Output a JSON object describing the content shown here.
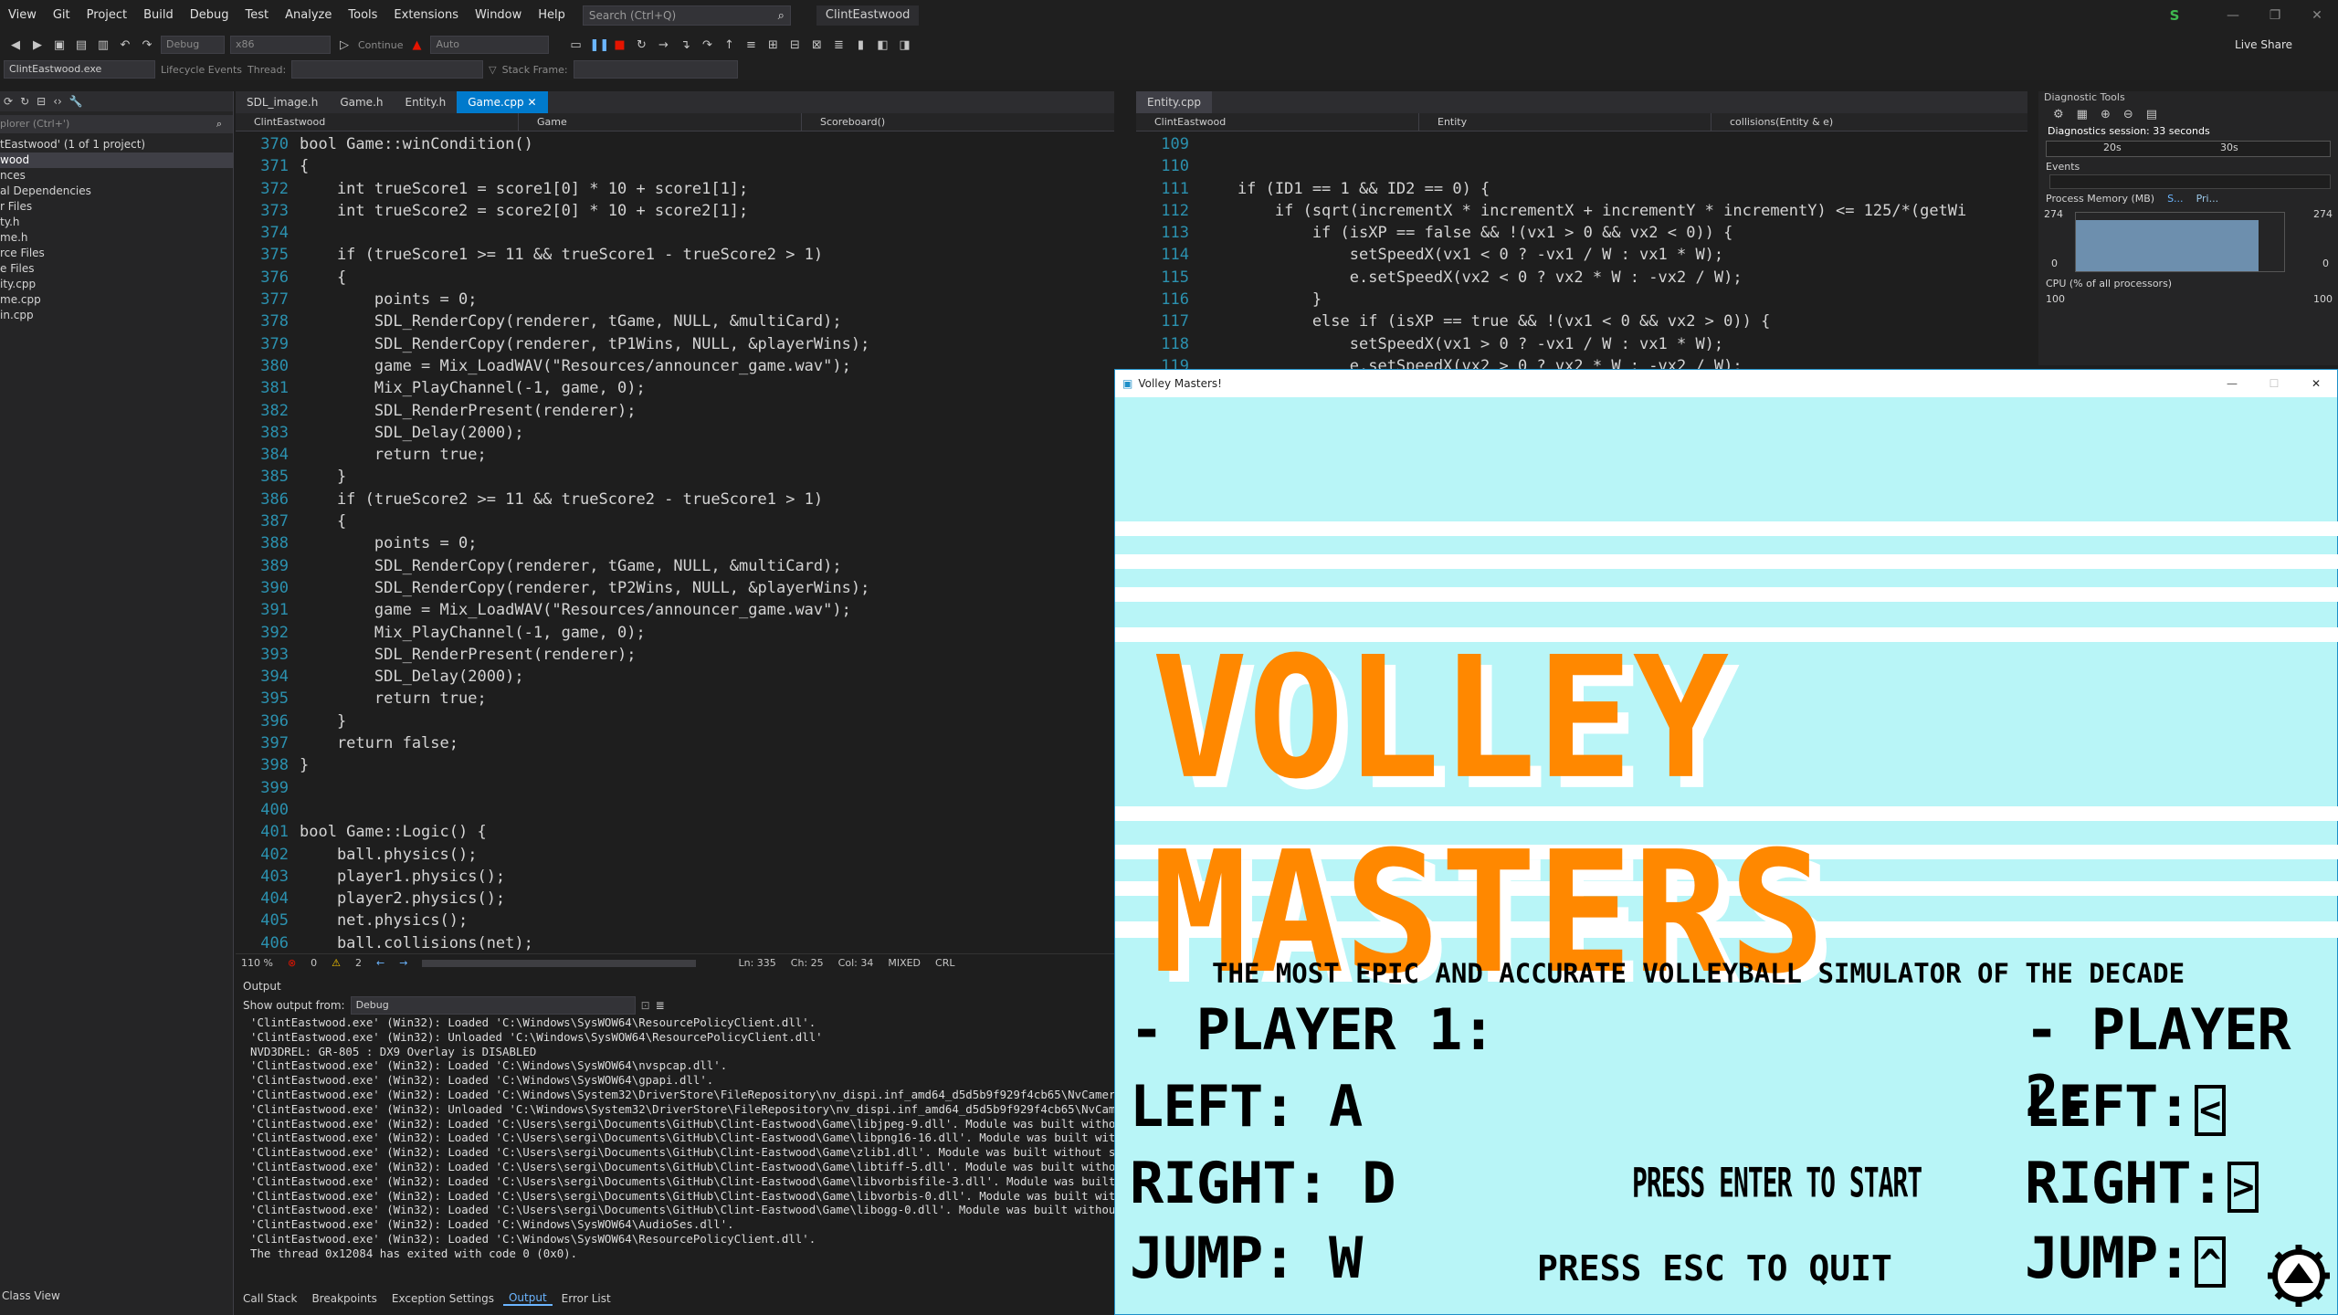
{
  "menu": {
    "items": [
      "View",
      "Git",
      "Project",
      "Build",
      "Debug",
      "Test",
      "Analyze",
      "Tools",
      "Extensions",
      "Window",
      "Help"
    ],
    "search_placeholder": "Search (Ctrl+Q)",
    "solution_name": "ClintEastwood",
    "user_initial": "S",
    "live_share": "Live Share"
  },
  "toolbar": {
    "config": "Debug",
    "platform": "x86",
    "continue": "Continue",
    "auto": "Auto",
    "process": "ClintEastwood.exe",
    "lifecycle": "Lifecycle Events",
    "thread": "Thread:",
    "stack_frame": "Stack Frame:"
  },
  "solution_explorer": {
    "search": "plorer (Ctrl+')",
    "rows": [
      "tEastwood' (1 of 1 project)",
      "wood",
      "nces",
      "al Dependencies",
      "r Files",
      "ty.h",
      "me.h",
      "rce Files",
      "e Files",
      "ity.cpp",
      "me.cpp",
      "in.cpp"
    ],
    "class_view": "Class View"
  },
  "editor_left": {
    "tabs": [
      "SDL_image.h",
      "Game.h",
      "Entity.h",
      "Game.cpp"
    ],
    "active_tab": "Game.cpp",
    "nav": [
      "ClintEastwood",
      "Game",
      "Scoreboard()"
    ],
    "zoom": "110 %",
    "errors": "0",
    "warnings": "2",
    "status_ln": "Ln: 335",
    "status_ch": "Ch: 25",
    "status_col": "Col: 34",
    "status_eol": "MIXED",
    "status_enc": "CRL"
  },
  "editor_right": {
    "tab": "Entity.cpp",
    "nav": [
      "ClintEastwood",
      "Entity",
      "collisions(Entity & e)"
    ]
  },
  "code_left": [
    {
      "n": "370",
      "t": "bool Game::winCondition()"
    },
    {
      "n": "371",
      "t": "{"
    },
    {
      "n": "372",
      "t": "    int trueScore1 = score1[0] * 10 + score1[1];"
    },
    {
      "n": "373",
      "t": "    int trueScore2 = score2[0] * 10 + score2[1];"
    },
    {
      "n": "374",
      "t": ""
    },
    {
      "n": "375",
      "t": "    if (trueScore1 >= 11 && trueScore1 - trueScore2 > 1)"
    },
    {
      "n": "376",
      "t": "    {"
    },
    {
      "n": "377",
      "t": "        points = 0;"
    },
    {
      "n": "378",
      "t": "        SDL_RenderCopy(renderer, tGame, NULL, &multiCard);"
    },
    {
      "n": "379",
      "t": "        SDL_RenderCopy(renderer, tP1Wins, NULL, &playerWins);"
    },
    {
      "n": "380",
      "t": "        game = Mix_LoadWAV(\"Resources/announcer_game.wav\");"
    },
    {
      "n": "381",
      "t": "        Mix_PlayChannel(-1, game, 0);"
    },
    {
      "n": "382",
      "t": "        SDL_RenderPresent(renderer);"
    },
    {
      "n": "383",
      "t": "        SDL_Delay(2000);"
    },
    {
      "n": "384",
      "t": "        return true;"
    },
    {
      "n": "385",
      "t": "    }"
    },
    {
      "n": "386",
      "t": "    if (trueScore2 >= 11 && trueScore2 - trueScore1 > 1)"
    },
    {
      "n": "387",
      "t": "    {"
    },
    {
      "n": "388",
      "t": "        points = 0;"
    },
    {
      "n": "389",
      "t": "        SDL_RenderCopy(renderer, tGame, NULL, &multiCard);"
    },
    {
      "n": "390",
      "t": "        SDL_RenderCopy(renderer, tP2Wins, NULL, &playerWins);"
    },
    {
      "n": "391",
      "t": "        game = Mix_LoadWAV(\"Resources/announcer_game.wav\");"
    },
    {
      "n": "392",
      "t": "        Mix_PlayChannel(-1, game, 0);"
    },
    {
      "n": "393",
      "t": "        SDL_RenderPresent(renderer);"
    },
    {
      "n": "394",
      "t": "        SDL_Delay(2000);"
    },
    {
      "n": "395",
      "t": "        return true;"
    },
    {
      "n": "396",
      "t": "    }"
    },
    {
      "n": "397",
      "t": "    return false;"
    },
    {
      "n": "398",
      "t": "}"
    },
    {
      "n": "399",
      "t": ""
    },
    {
      "n": "400",
      "t": ""
    },
    {
      "n": "401",
      "t": "bool Game::Logic() {"
    },
    {
      "n": "402",
      "t": "    ball.physics();"
    },
    {
      "n": "403",
      "t": "    player1.physics();"
    },
    {
      "n": "404",
      "t": "    player2.physics();"
    },
    {
      "n": "405",
      "t": "    net.physics();"
    },
    {
      "n": "406",
      "t": "    ball.collisions(net);"
    }
  ],
  "code_right": [
    {
      "n": "109",
      "t": ""
    },
    {
      "n": "110",
      "t": ""
    },
    {
      "n": "111",
      "t": "    if (ID1 == 1 && ID2 == 0) {"
    },
    {
      "n": "112",
      "t": "        if (sqrt(incrementX * incrementX + incrementY * incrementY) <= 125/*(getWi"
    },
    {
      "n": "113",
      "t": "            if (isXP == false && !(vx1 > 0 && vx2 < 0)) {"
    },
    {
      "n": "114",
      "t": "                setSpeedX(vx1 < 0 ? -vx1 / W : vx1 * W);"
    },
    {
      "n": "115",
      "t": "                e.setSpeedX(vx2 < 0 ? vx2 * W : -vx2 / W);"
    },
    {
      "n": "116",
      "t": "            }"
    },
    {
      "n": "117",
      "t": "            else if (isXP == true && !(vx1 < 0 && vx2 > 0)) {"
    },
    {
      "n": "118",
      "t": "                setSpeedX(vx1 > 0 ? -vx1 / W : vx1 * W);"
    },
    {
      "n": "119",
      "t": "                e.setSpeedX(vx2 > 0 ? vx2 * W : -vx2 / W);"
    }
  ],
  "output": {
    "title": "Output",
    "show_from_label": "Show output from:",
    "source": "Debug",
    "lines": [
      "'ClintEastwood.exe' (Win32): Loaded 'C:\\Windows\\SysWOW64\\ResourcePolicyClient.dll'.",
      "'ClintEastwood.exe' (Win32): Unloaded 'C:\\Windows\\SysWOW64\\ResourcePolicyClient.dll'",
      "NVD3DREL: GR-805 : DX9 Overlay is DISABLED",
      "'ClintEastwood.exe' (Win32): Loaded 'C:\\Windows\\SysWOW64\\nvspcap.dll'.",
      "'ClintEastwood.exe' (Win32): Loaded 'C:\\Windows\\SysWOW64\\gpapi.dll'.",
      "'ClintEastwood.exe' (Win32): Loaded 'C:\\Windows\\System32\\DriverStore\\FileRepository\\nv_dispi.inf_amd64_d5d5b9f929f4cb65\\NvCamera\\",
      "'ClintEastwood.exe' (Win32): Unloaded 'C:\\Windows\\System32\\DriverStore\\FileRepository\\nv_dispi.inf_amd64_d5d5b9f929f4cb65\\NvCamer",
      "'ClintEastwood.exe' (Win32): Loaded 'C:\\Users\\sergi\\Documents\\GitHub\\Clint-Eastwood\\Game\\libjpeg-9.dll'. Module was built without",
      "'ClintEastwood.exe' (Win32): Loaded 'C:\\Users\\sergi\\Documents\\GitHub\\Clint-Eastwood\\Game\\libpng16-16.dll'. Module was built witho",
      "'ClintEastwood.exe' (Win32): Loaded 'C:\\Users\\sergi\\Documents\\GitHub\\Clint-Eastwood\\Game\\zlib1.dll'. Module was built without sym",
      "'ClintEastwood.exe' (Win32): Loaded 'C:\\Users\\sergi\\Documents\\GitHub\\Clint-Eastwood\\Game\\libtiff-5.dll'. Module was built without",
      "'ClintEastwood.exe' (Win32): Loaded 'C:\\Users\\sergi\\Documents\\GitHub\\Clint-Eastwood\\Game\\libvorbisfile-3.dll'. Module was built wi",
      "'ClintEastwood.exe' (Win32): Loaded 'C:\\Users\\sergi\\Documents\\GitHub\\Clint-Eastwood\\Game\\libvorbis-0.dll'. Module was built witho",
      "'ClintEastwood.exe' (Win32): Loaded 'C:\\Users\\sergi\\Documents\\GitHub\\Clint-Eastwood\\Game\\libogg-0.dll'. Module was built without",
      "'ClintEastwood.exe' (Win32): Loaded 'C:\\Windows\\SysWOW64\\AudioSes.dll'.",
      "'ClintEastwood.exe' (Win32): Loaded 'C:\\Windows\\SysWOW64\\ResourcePolicyClient.dll'.",
      "The thread 0x12084 has exited with code 0 (0x0)."
    ]
  },
  "bottom_tabs": [
    "Call Stack",
    "Breakpoints",
    "Exception Settings",
    "Output",
    "Error List"
  ],
  "active_bottom_tab": "Output",
  "diagnostics": {
    "title": "Diagnostic Tools",
    "session": "Diagnostics session: 33 seconds",
    "tick_20": "20s",
    "tick_30": "30s",
    "events": "Events",
    "memory": "Process Memory (MB)",
    "legend_s": "S...",
    "legend_p": "Pri...",
    "mem_max": "274",
    "mem_min": "0",
    "cpu": "CPU (% of all processors)",
    "cpu_max": "100"
  },
  "game": {
    "window_title": "Volley Masters!",
    "logo": "VOLLEY MASTERS",
    "subtitle": "THE MOST EPIC AND ACCURATE VOLLEYBALL SIMULATOR OF THE DECADE",
    "p1_title": "- PLAYER 1:",
    "p1_left": "LEFT: A",
    "p1_right": "RIGHT: D",
    "p1_jump": "JUMP: W",
    "p2_title": "- PLAYER 2:",
    "p2_left": "LEFT:",
    "p2_right": "RIGHT:",
    "p2_jump": "JUMP:",
    "p2_left_key": "<",
    "p2_right_key": ">",
    "p2_jump_key": "^",
    "press_enter": "PRESS ENTER TO START",
    "press_esc": "PRESS ESC TO QUIT",
    "colors": {
      "bg": "#b8f5f7",
      "stripe": "#ffffff",
      "logo": "#ff8800"
    }
  }
}
